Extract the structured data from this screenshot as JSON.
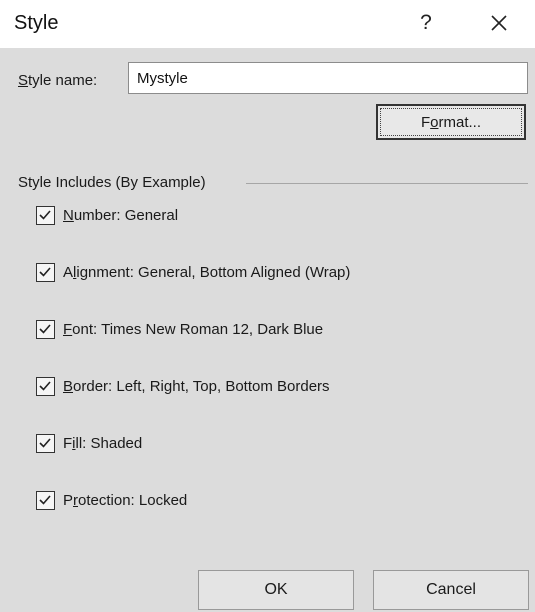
{
  "dialog": {
    "title": "Style",
    "help_label": "?"
  },
  "style_name": {
    "label": "Style name:",
    "value": "Mystyle"
  },
  "format_button": {
    "label": "Format..."
  },
  "group": {
    "label": "Style Includes (By Example)",
    "items": [
      {
        "label": "Number: General",
        "checked": true
      },
      {
        "label": "Alignment: General, Bottom Aligned (Wrap)",
        "checked": true
      },
      {
        "label": "Font: Times New Roman 12, Dark Blue",
        "checked": true
      },
      {
        "label": "Border: Left, Right, Top, Bottom Borders",
        "checked": true
      },
      {
        "label": "Fill: Shaded",
        "checked": true
      },
      {
        "label": "Protection: Locked",
        "checked": true
      }
    ]
  },
  "footer": {
    "ok_label": "OK",
    "cancel_label": "Cancel"
  },
  "icons": {
    "close": "close-icon",
    "check": "checkmark-icon"
  }
}
